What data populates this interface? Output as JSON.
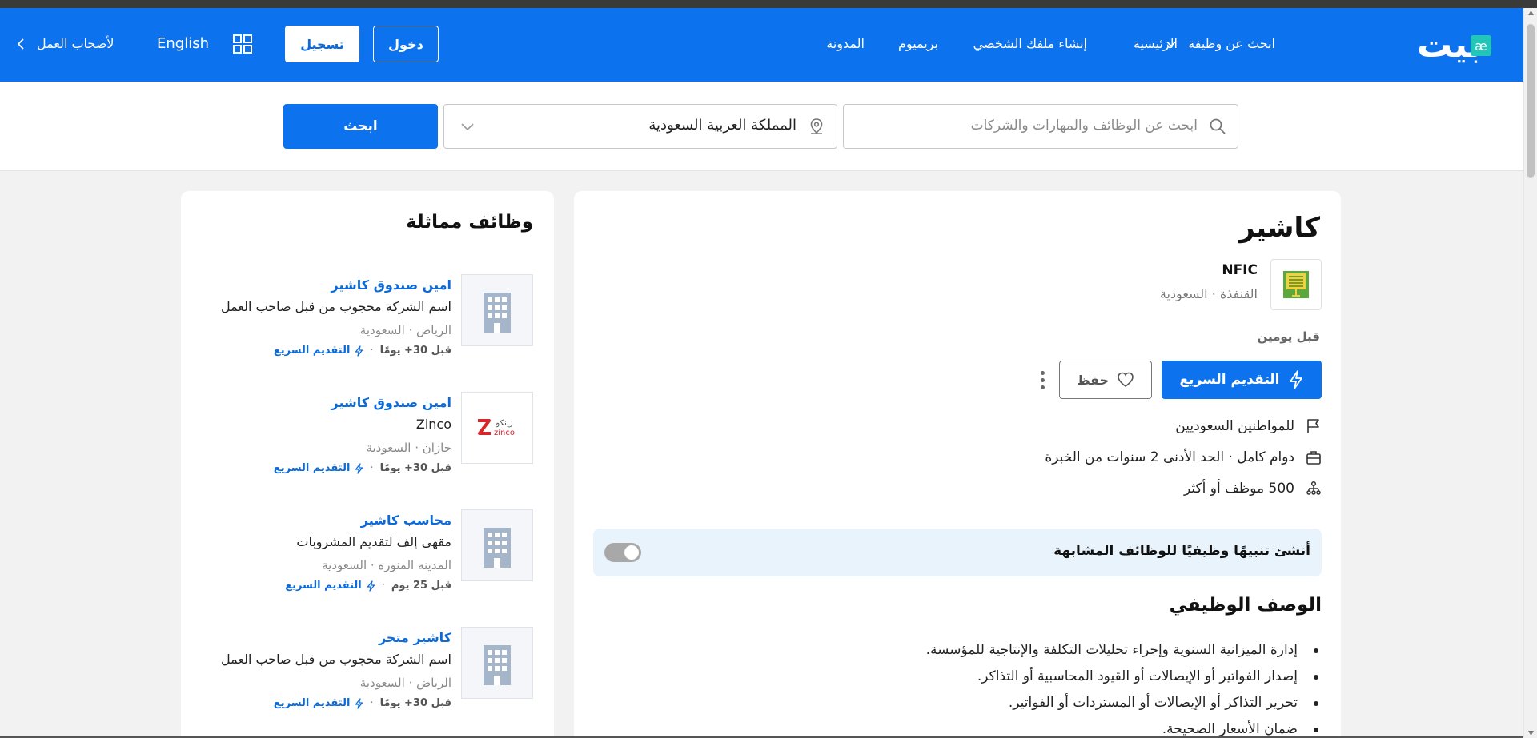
{
  "nav": {
    "logo_text": "بيت",
    "logo_badge": "æ",
    "home": "الرئيسية",
    "find_job": "ابحث عن وظيفة",
    "create_profile": "إنشاء ملفك الشخصي",
    "premium": "بريميوم",
    "blog": "المدونة",
    "login": "دخول",
    "register": "تسجيل",
    "language": "English",
    "employers": "لأصحاب العمل"
  },
  "search": {
    "placeholder": "ابحث عن الوظائف والمهارات والشركات",
    "location": "المملكة العربية السعودية",
    "button": "ابحث"
  },
  "job": {
    "title": "كاشير",
    "company": "NFIC",
    "location": "القنفذة · السعودية",
    "posted": "قبل يومين",
    "quick_apply": "التقديم السريع",
    "save": "حفظ",
    "facts": [
      {
        "icon": "flag-icon",
        "text": "للمواطنين السعوديين"
      },
      {
        "icon": "briefcase-icon",
        "text": "دوام كامل · الحد الأدنى 2 سنوات من الخبرة"
      },
      {
        "icon": "org-chart-icon",
        "text": "500 موظف أو أكثر"
      }
    ],
    "alert_text": "أنشئ تنبيهًا وظيفيًا للوظائف المشابهة",
    "alert_enabled": false,
    "description_title": "الوصف الوظيفي",
    "description": [
      "إدارة الميزانية السنوية وإجراء تحليلات التكلفة والإنتاجية للمؤسسة.",
      "إصدار الفواتير أو الإيصالات أو القيود المحاسبية أو التذاكر.",
      "تحرير التذاكر أو الإيصالات أو المستردات أو الفواتير.",
      "ضمان الأسعار الصحيحة."
    ]
  },
  "similar": {
    "title": "وظائف مماثلة",
    "items": [
      {
        "title": "امين صندوق كاشير",
        "company": "اسم الشركة محجوب من قبل صاحب العمل",
        "location": "الرياض · السعودية",
        "ago": "قبل 30+ يومًا",
        "quick_apply": "التقديم السريع",
        "logo": "building-icon"
      },
      {
        "title": "امين صندوق كاشير",
        "company": "Zinco",
        "location": "جازان · السعودية",
        "ago": "قبل 30+ يومًا",
        "quick_apply": "التقديم السريع",
        "logo": "zinco-logo"
      },
      {
        "title": "محاسب كاشير",
        "company": "مقهى إلف لتقديم المشروبات",
        "location": "المدينه المنوره · السعودية",
        "ago": "قبل 25 يوم",
        "quick_apply": "التقديم السريع",
        "logo": "building-icon"
      },
      {
        "title": "كاشير متجر",
        "company": "اسم الشركة محجوب من قبل صاحب العمل",
        "location": "الرياض · السعودية",
        "ago": "قبل 30+ يومًا",
        "quick_apply": "التقديم السريع",
        "logo": "building-icon"
      }
    ]
  },
  "zinco_logo_text": {
    "arabic": "زينكو",
    "latin": "zinco"
  },
  "colors": {
    "brand": "#0c72ed",
    "teal": "#22c6b8",
    "alert_bg": "#e8f3fc",
    "link": "#0c6bd9"
  }
}
